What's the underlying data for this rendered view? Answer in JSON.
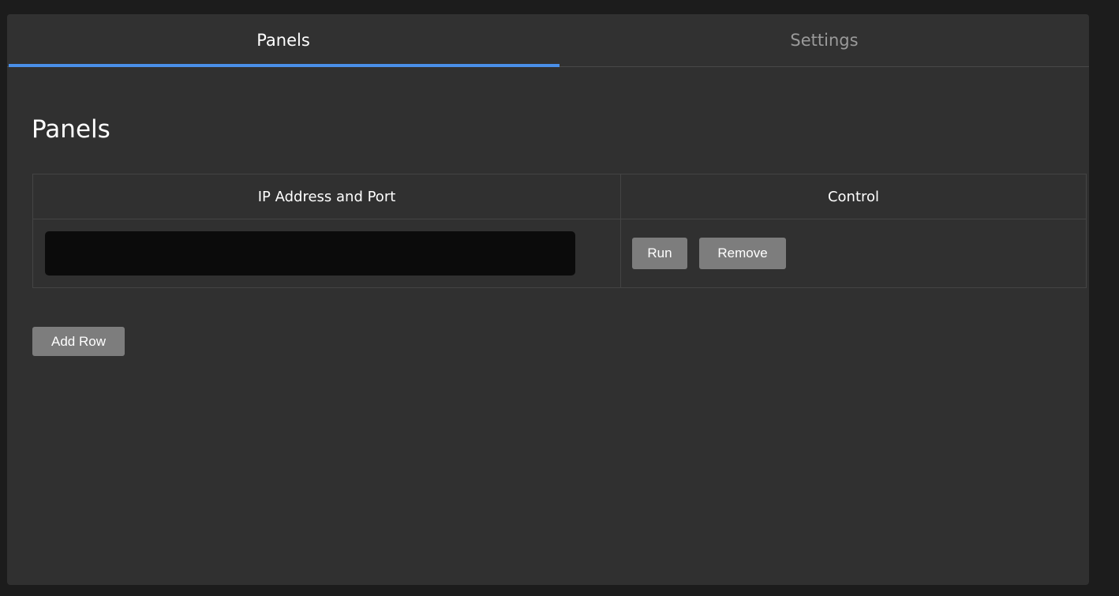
{
  "tabs": [
    {
      "label": "Panels",
      "active": true
    },
    {
      "label": "Settings",
      "active": false
    }
  ],
  "page": {
    "title": "Panels"
  },
  "table": {
    "columns": [
      "IP Address and Port",
      "Control"
    ],
    "rows": [
      {
        "ip_value": "",
        "ip_placeholder": ""
      }
    ]
  },
  "buttons": {
    "run_label": "Run",
    "remove_label": "Remove",
    "add_row_label": "Add Row"
  },
  "colors": {
    "accent": "#4a8fe8",
    "background": "#303030",
    "button": "#7d7d7d",
    "input": "#0b0b0b"
  }
}
